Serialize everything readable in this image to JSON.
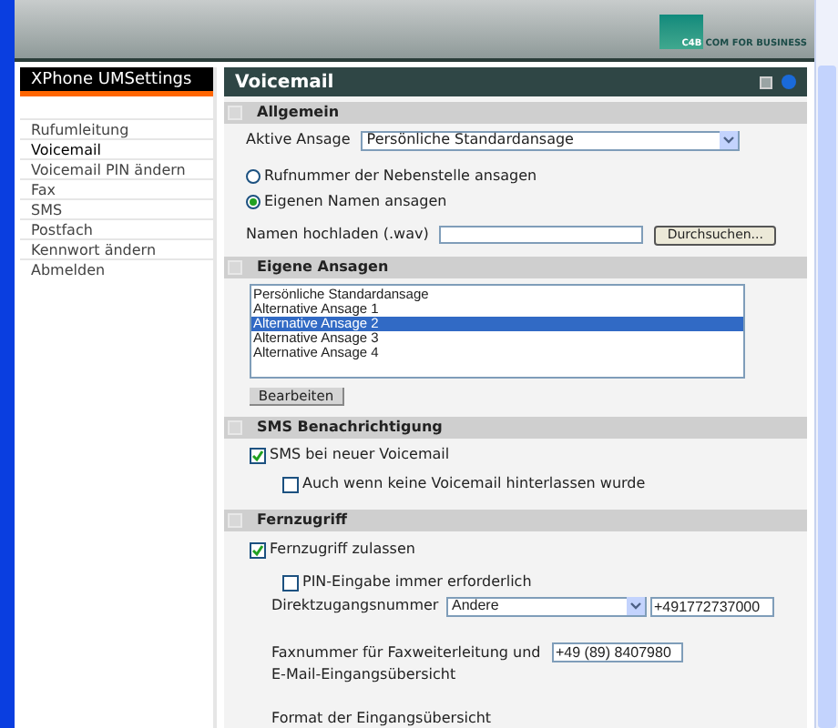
{
  "logo": {
    "text": "C4B",
    "tagline": "COM FOR BUSINESS"
  },
  "sidebar": {
    "title": "XPhone  UMSettings",
    "items": [
      {
        "label": "Rufumleitung",
        "selected": false
      },
      {
        "label": "Voicemail",
        "selected": true
      },
      {
        "label": "Voicemail PIN ändern",
        "selected": false
      },
      {
        "label": "Fax",
        "selected": false
      },
      {
        "label": "SMS",
        "selected": false
      },
      {
        "label": "Postfach",
        "selected": false
      },
      {
        "label": "Kennwort ändern",
        "selected": false
      },
      {
        "label": "Abmelden",
        "selected": false
      }
    ]
  },
  "page_title": "Voicemail",
  "allgemein": {
    "title": "Allgemein",
    "active_label": "Aktive Ansage",
    "active_value": "Persönliche Standardansage",
    "radios": [
      {
        "label": "Rufnummer der Nebenstelle ansagen",
        "selected": false
      },
      {
        "label": "Eigenen Namen ansagen",
        "selected": true
      }
    ],
    "upload_label": "Namen hochladen (.wav)",
    "browse_button": "Durchsuchen..."
  },
  "eigene": {
    "title": "Eigene Ansagen",
    "items": [
      {
        "label": "Persönliche Standardansage",
        "selected": false
      },
      {
        "label": "Alternative Ansage 1",
        "selected": false
      },
      {
        "label": "Alternative Ansage 2",
        "selected": true
      },
      {
        "label": "Alternative Ansage 3",
        "selected": false
      },
      {
        "label": "Alternative Ansage 4",
        "selected": false
      }
    ],
    "edit_button": "Bearbeiten"
  },
  "sms": {
    "title": "SMS Benachrichtigung",
    "checks": [
      {
        "label": "SMS bei neuer Voicemail",
        "checked": true,
        "children": [
          {
            "label": "Auch wenn keine Voicemail hinterlassen wurde",
            "checked": false
          }
        ]
      }
    ]
  },
  "fern": {
    "title": "Fernzugriff",
    "checks": [
      {
        "label": "Fernzugriff zulassen",
        "checked": true,
        "children": [
          {
            "label": "PIN-Eingabe immer erforderlich",
            "checked": false
          }
        ]
      }
    ],
    "direct_label": "Direktzugangsnummer",
    "direct_select": "Andere",
    "direct_value": "+491772737000",
    "fax_label": "Faxnummer für Faxweiterleitung und E-Mail-Eingangsübersicht",
    "fax_value": "+49 (89) 8407980",
    "format_label": "Format der Eingangsübersicht"
  }
}
